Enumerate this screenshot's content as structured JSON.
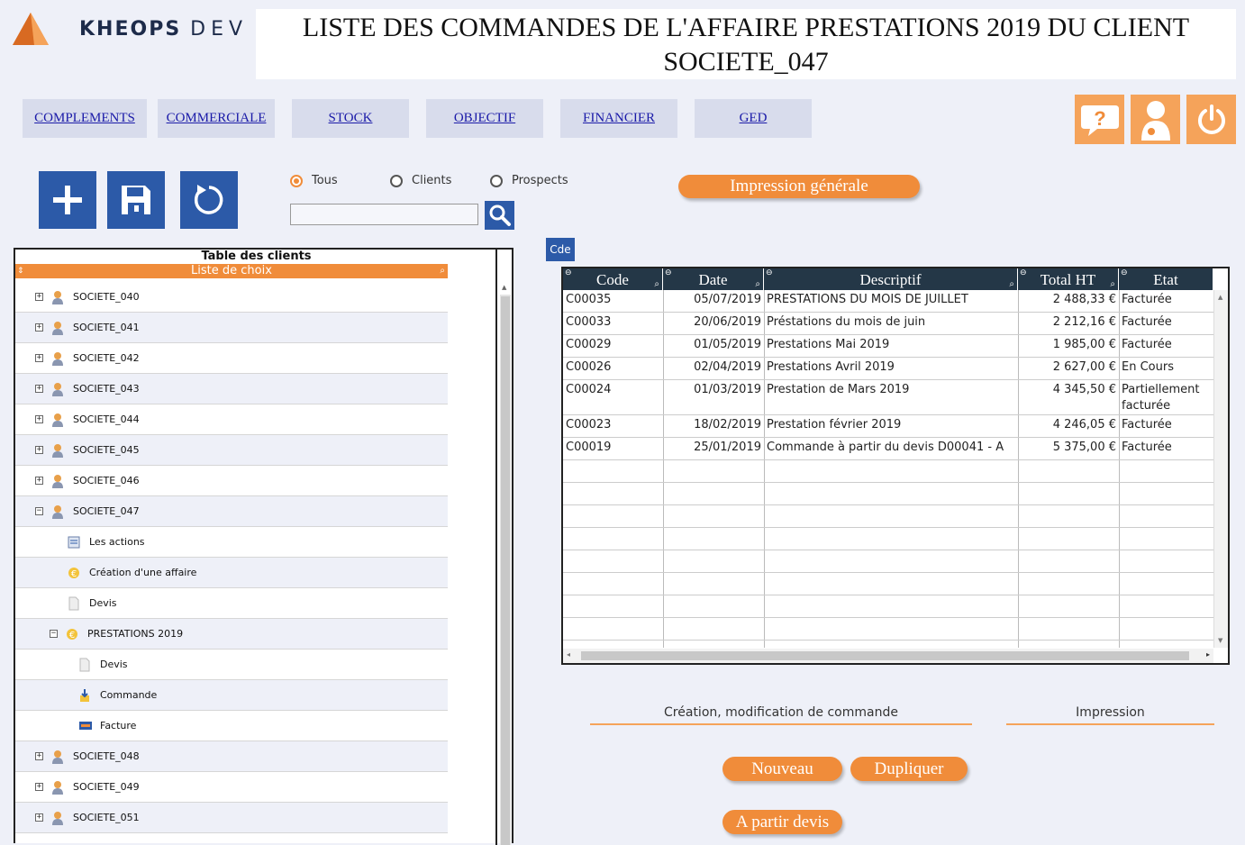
{
  "header": {
    "logo_text": "KHEOPS",
    "logo_suffix": "DEV",
    "title": "LISTE DES COMMANDES DE L'AFFAIRE PRESTATIONS 2019 DU CLIENT SOCIETE_047"
  },
  "nav": [
    "COMPLEMENTS",
    "COMMERCIALE",
    "STOCK",
    "OBJECTIF",
    "FINANCIER",
    "GED"
  ],
  "top_icons": [
    "help-icon",
    "user-icon",
    "power-icon"
  ],
  "toolbar": {
    "buttons": [
      "add-icon",
      "save-icon",
      "refresh-icon"
    ],
    "filter_options": [
      {
        "label": "Tous",
        "selected": true
      },
      {
        "label": "Clients",
        "selected": false
      },
      {
        "label": "Prospects",
        "selected": false
      }
    ],
    "search_placeholder": "",
    "print_all_label": "Impression générale"
  },
  "tree": {
    "title": "Table des clients",
    "chooser": "Liste de choix",
    "rows": [
      {
        "label": "SOCIETE_040",
        "level": 0,
        "expand": "+",
        "icon": "client-icon"
      },
      {
        "label": "SOCIETE_041",
        "level": 0,
        "expand": "+",
        "icon": "client-icon"
      },
      {
        "label": "SOCIETE_042",
        "level": 0,
        "expand": "+",
        "icon": "client-icon"
      },
      {
        "label": "SOCIETE_043",
        "level": 0,
        "expand": "+",
        "icon": "client-icon"
      },
      {
        "label": "SOCIETE_044",
        "level": 0,
        "expand": "+",
        "icon": "client-icon"
      },
      {
        "label": "SOCIETE_045",
        "level": 0,
        "expand": "+",
        "icon": "client-icon"
      },
      {
        "label": "SOCIETE_046",
        "level": 0,
        "expand": "+",
        "icon": "client-icon"
      },
      {
        "label": "SOCIETE_047",
        "level": 0,
        "expand": "−",
        "icon": "client-icon"
      },
      {
        "label": "Les actions",
        "level": 1,
        "expand": "",
        "icon": "actions-icon"
      },
      {
        "label": "Création d'une affaire",
        "level": 1,
        "expand": "",
        "icon": "euro-icon"
      },
      {
        "label": "Devis",
        "level": 1,
        "expand": "",
        "icon": "document-icon"
      },
      {
        "label": "PRESTATIONS 2019",
        "level": 1,
        "expand": "−",
        "icon": "euro-icon"
      },
      {
        "label": "Devis",
        "level": 2,
        "expand": "",
        "icon": "document-icon"
      },
      {
        "label": "Commande",
        "level": 2,
        "expand": "",
        "icon": "order-icon"
      },
      {
        "label": "Facture",
        "level": 2,
        "expand": "",
        "icon": "invoice-icon"
      },
      {
        "label": "SOCIETE_048",
        "level": 0,
        "expand": "+",
        "icon": "client-icon"
      },
      {
        "label": "SOCIETE_049",
        "level": 0,
        "expand": "+",
        "icon": "client-icon"
      },
      {
        "label": "SOCIETE_051",
        "level": 0,
        "expand": "+",
        "icon": "client-icon"
      }
    ]
  },
  "grid": {
    "tab_label": "Cde",
    "columns": [
      "Code",
      "Date",
      "Descriptif",
      "Total HT",
      "Etat"
    ],
    "rows": [
      [
        "C00035",
        "05/07/2019",
        "PRESTATIONS DU MOIS DE JUILLET",
        "2 488,33 €",
        "Facturée"
      ],
      [
        "C00033",
        "20/06/2019",
        "Préstations du mois de juin",
        "2 212,16 €",
        "Facturée"
      ],
      [
        "C00029",
        "01/05/2019",
        "Prestations Mai 2019",
        "1 985,00 €",
        "Facturée"
      ],
      [
        "C00026",
        "02/04/2019",
        "Prestations Avril 2019",
        "2 627,00 €",
        "En Cours"
      ],
      [
        "C00024",
        "01/03/2019",
        "Prestation de Mars 2019",
        "4 345,50 €",
        "Partiellement facturée"
      ],
      [
        "C00023",
        "18/02/2019",
        "Prestation février 2019",
        "4 246,05 €",
        "Facturée"
      ],
      [
        "C00019",
        "25/01/2019",
        "Commande à partir du devis D00041 - A",
        "5 375,00 €",
        "Facturée"
      ]
    ]
  },
  "sections": {
    "edit_label": "Création, modification de commande",
    "print_label": "Impression"
  },
  "actions": {
    "new_label": "Nouveau",
    "duplicate_label": "Dupliquer",
    "from_quote_label": "A partir devis"
  },
  "colors": {
    "accent": "#f08c3a",
    "primary": "#2c5aa8",
    "grid_header": "#243747",
    "background": "#eef0f8"
  }
}
